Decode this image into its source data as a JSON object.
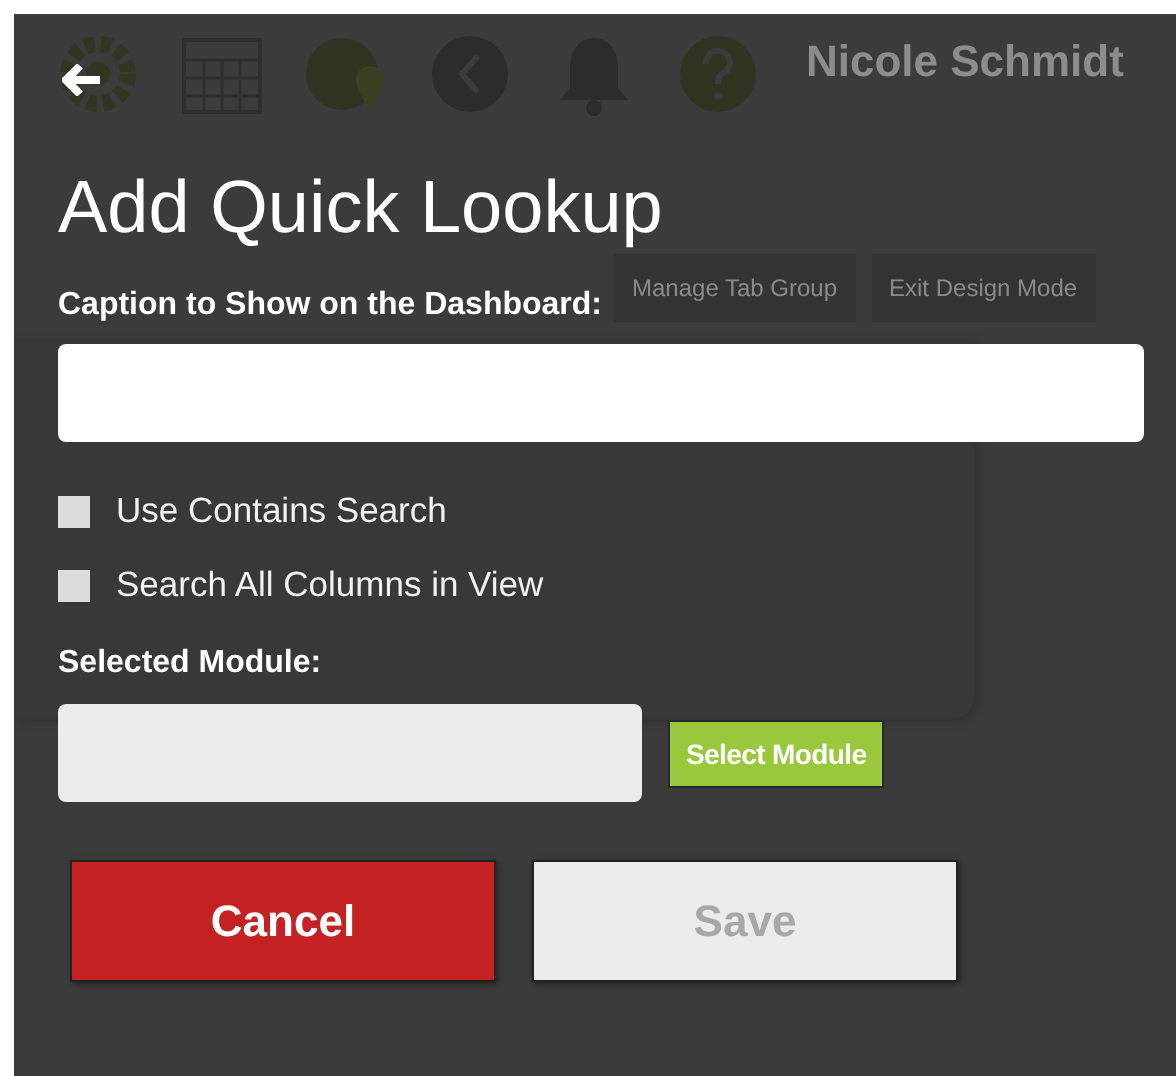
{
  "backdrop": {
    "user_name": "Nicole Schmidt",
    "buttons": [
      "Manage Tab Group",
      "Exit Design Mode"
    ]
  },
  "dialog": {
    "title": "Add Quick Lookup",
    "caption_label": "Caption to Show on the Dashboard:",
    "options": [
      {
        "label": "Use Contains Search",
        "checked": false
      },
      {
        "label": "Search All Columns in View",
        "checked": false
      }
    ],
    "module_label": "Selected Module:",
    "select_button": "Select Module",
    "buttons": [
      {
        "label": "Cancel",
        "kind": "cancel",
        "disabled": false
      },
      {
        "label": "Save",
        "kind": "save",
        "disabled": true
      }
    ]
  }
}
